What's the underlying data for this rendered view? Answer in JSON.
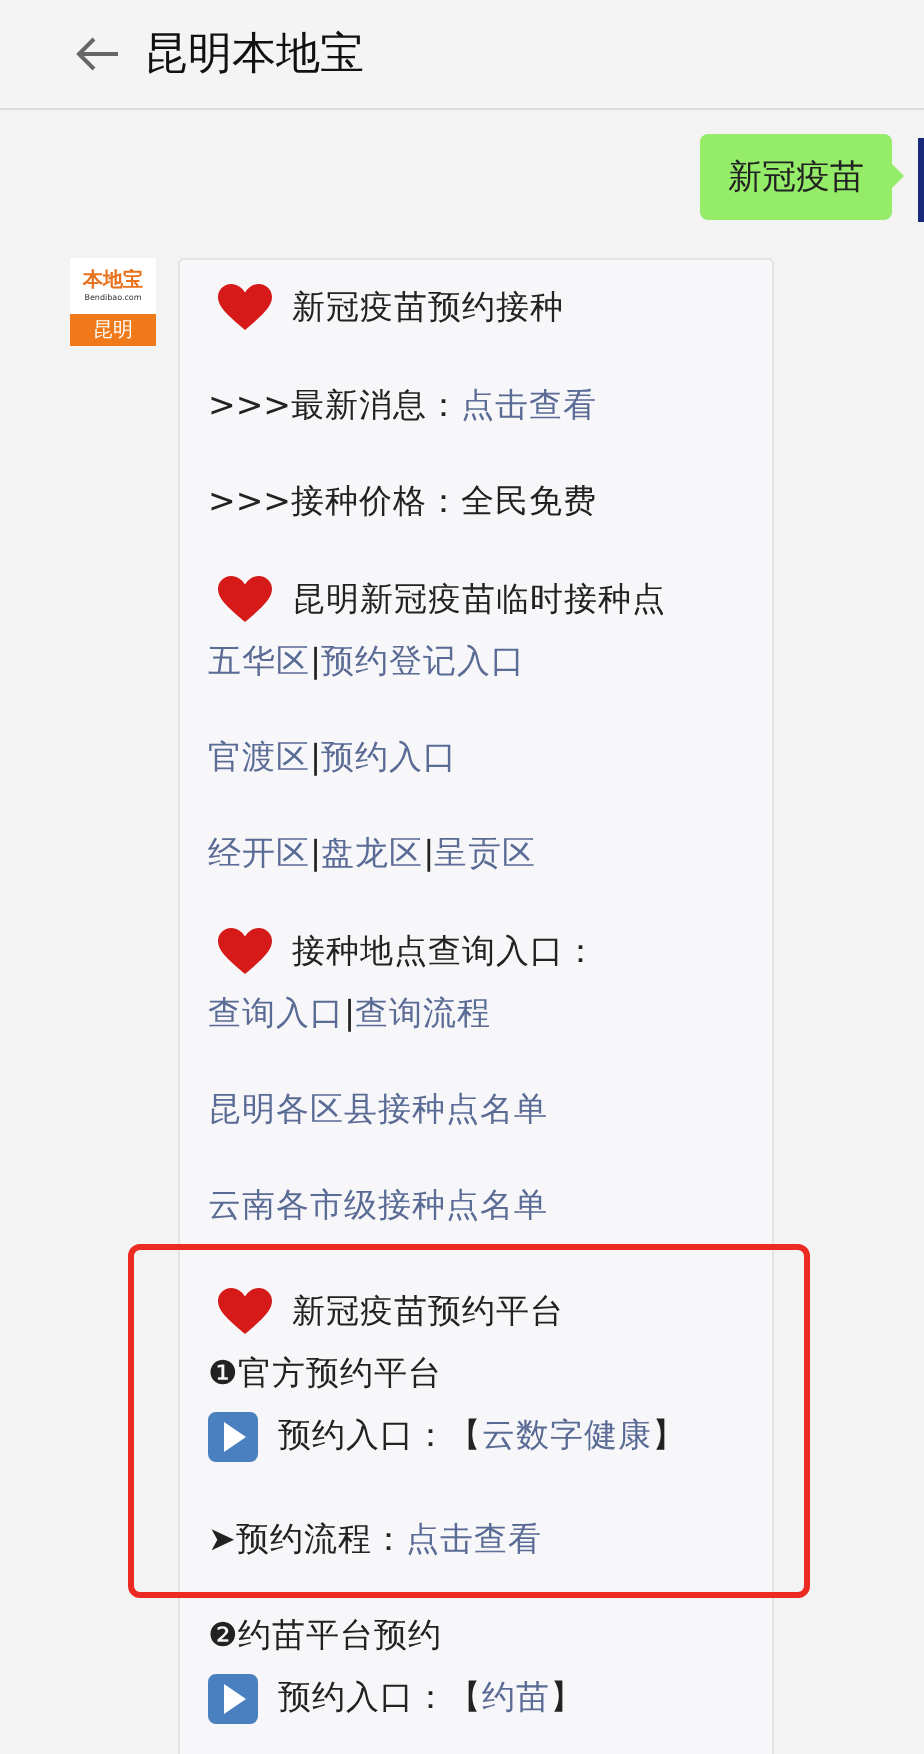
{
  "header": {
    "title": "昆明本地宝"
  },
  "sent_message": {
    "text": "新冠疫苗"
  },
  "sender": {
    "logo_text": "本地宝",
    "logo_domain": "Bendibao.com",
    "logo_city": "昆明"
  },
  "blocks": [
    {
      "kind": "group",
      "lines": [
        {
          "kind": "heading",
          "parts": [
            {
              "kind": "text",
              "text": "新冠疫苗预约接种"
            }
          ]
        }
      ]
    },
    {
      "kind": "group",
      "lines": [
        {
          "kind": "line",
          "parts": [
            {
              "kind": "text",
              "text": ">>>最新消息："
            },
            {
              "kind": "link",
              "text": "点击查看"
            }
          ]
        }
      ]
    },
    {
      "kind": "group",
      "lines": [
        {
          "kind": "line",
          "parts": [
            {
              "kind": "text",
              "text": ">>>接种价格：全民免费"
            }
          ]
        }
      ]
    },
    {
      "kind": "group",
      "lines": [
        {
          "kind": "heading",
          "parts": [
            {
              "kind": "text",
              "text": "昆明新冠疫苗临时接种点"
            }
          ]
        },
        {
          "kind": "line",
          "parts": [
            {
              "kind": "link",
              "text": "五华区"
            },
            {
              "kind": "separator",
              "text": "|"
            },
            {
              "kind": "link",
              "text": "预约登记入口"
            }
          ]
        }
      ]
    },
    {
      "kind": "group",
      "lines": [
        {
          "kind": "line",
          "parts": [
            {
              "kind": "link",
              "text": "官渡区"
            },
            {
              "kind": "separator",
              "text": "|"
            },
            {
              "kind": "link",
              "text": "预约入口"
            }
          ]
        }
      ]
    },
    {
      "kind": "group",
      "lines": [
        {
          "kind": "line",
          "parts": [
            {
              "kind": "link",
              "text": "经开区"
            },
            {
              "kind": "separator",
              "text": "|"
            },
            {
              "kind": "link",
              "text": "盘龙区"
            },
            {
              "kind": "separator",
              "text": "|"
            },
            {
              "kind": "link",
              "text": "呈贡区"
            }
          ]
        }
      ]
    },
    {
      "kind": "group",
      "lines": [
        {
          "kind": "heading",
          "parts": [
            {
              "kind": "text",
              "text": "接种地点查询入口："
            }
          ]
        },
        {
          "kind": "line",
          "parts": [
            {
              "kind": "link",
              "text": "查询入口"
            },
            {
              "kind": "separator",
              "text": "|"
            },
            {
              "kind": "link",
              "text": "查询流程"
            }
          ]
        }
      ]
    },
    {
      "kind": "group",
      "lines": [
        {
          "kind": "line",
          "parts": [
            {
              "kind": "link",
              "text": "昆明各区县接种点名单"
            }
          ]
        }
      ]
    },
    {
      "kind": "group",
      "lines": [
        {
          "kind": "line",
          "parts": [
            {
              "kind": "link",
              "text": "云南各市级接种点名单"
            }
          ]
        }
      ]
    },
    {
      "kind": "highlight_frame",
      "groups": [
        {
          "lines": [
            {
              "kind": "heading",
              "parts": [
                {
                  "kind": "text",
                  "text": "新冠疫苗预约平台"
                }
              ]
            },
            {
              "kind": "line",
              "parts": [
                {
                  "kind": "text",
                  "text": "❶官方预约平台"
                }
              ]
            },
            {
              "kind": "play",
              "parts": [
                {
                  "kind": "text",
                  "text": "预约入口：【"
                },
                {
                  "kind": "link",
                  "text": "云数字健康"
                },
                {
                  "kind": "text",
                  "text": "】"
                }
              ]
            }
          ]
        },
        {
          "lines": [
            {
              "kind": "line",
              "parts": [
                {
                  "kind": "text",
                  "text": "➤预约流程："
                },
                {
                  "kind": "link",
                  "text": "点击查看"
                }
              ]
            }
          ]
        }
      ]
    },
    {
      "kind": "group",
      "lines": [
        {
          "kind": "line",
          "parts": [
            {
              "kind": "text",
              "text": "❷约苗平台预约"
            }
          ]
        },
        {
          "kind": "play",
          "parts": [
            {
              "kind": "text",
              "text": "预约入口：【"
            },
            {
              "kind": "link",
              "text": "约苗"
            },
            {
              "kind": "text",
              "text": "】"
            }
          ]
        }
      ]
    }
  ]
}
